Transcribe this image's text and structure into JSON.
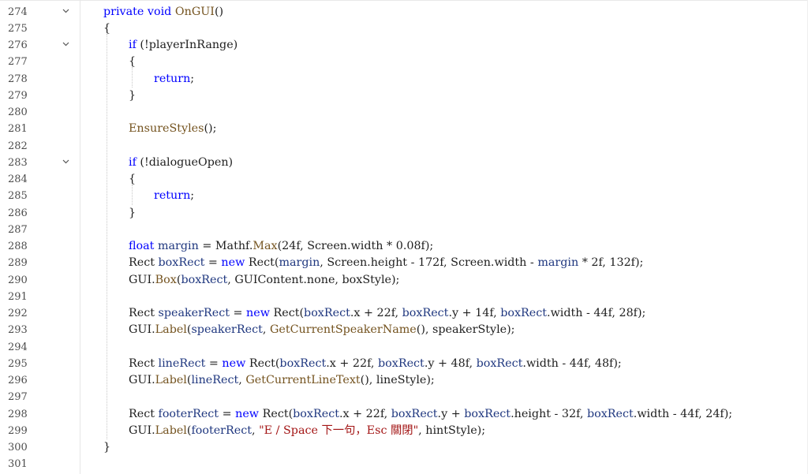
{
  "colors": {
    "keyword": "#0000ff",
    "type": "#2b91af",
    "variable": "#1f377f",
    "string": "#a31515",
    "method": "#74531f",
    "plain": "#1e1e1e",
    "line_number": "#4d4d4d"
  },
  "fold_icon": "chevron-down-icon",
  "lines": [
    {
      "n": "274",
      "fold": true,
      "indent": 0,
      "tokens": [
        {
          "t": "private",
          "c": "kw"
        },
        {
          "t": " ",
          "c": "txt"
        },
        {
          "t": "void",
          "c": "kw"
        },
        {
          "t": " ",
          "c": "txt"
        },
        {
          "t": "OnGUI",
          "c": "mth"
        },
        {
          "t": "()",
          "c": "txt"
        }
      ]
    },
    {
      "n": "275",
      "fold": false,
      "indent": 0,
      "tokens": [
        {
          "t": "{",
          "c": "txt"
        }
      ]
    },
    {
      "n": "276",
      "fold": true,
      "indent": 1,
      "tokens": [
        {
          "t": "if",
          "c": "kw"
        },
        {
          "t": " (!",
          "c": "txt"
        },
        {
          "t": "playerInRange",
          "c": "txt"
        },
        {
          "t": ")",
          "c": "txt"
        }
      ]
    },
    {
      "n": "277",
      "fold": false,
      "indent": 1,
      "tokens": [
        {
          "t": "{",
          "c": "txt"
        }
      ]
    },
    {
      "n": "278",
      "fold": false,
      "indent": 2,
      "tokens": [
        {
          "t": "return",
          "c": "kw"
        },
        {
          "t": ";",
          "c": "txt"
        }
      ]
    },
    {
      "n": "279",
      "fold": false,
      "indent": 1,
      "tokens": [
        {
          "t": "}",
          "c": "txt"
        }
      ]
    },
    {
      "n": "280",
      "fold": false,
      "indent": 0,
      "tokens": []
    },
    {
      "n": "281",
      "fold": false,
      "indent": 1,
      "tokens": [
        {
          "t": "EnsureStyles",
          "c": "mth"
        },
        {
          "t": "();",
          "c": "txt"
        }
      ]
    },
    {
      "n": "282",
      "fold": false,
      "indent": 0,
      "tokens": []
    },
    {
      "n": "283",
      "fold": true,
      "indent": 1,
      "tokens": [
        {
          "t": "if",
          "c": "kw"
        },
        {
          "t": " (!",
          "c": "txt"
        },
        {
          "t": "dialogueOpen",
          "c": "txt"
        },
        {
          "t": ")",
          "c": "txt"
        }
      ]
    },
    {
      "n": "284",
      "fold": false,
      "indent": 1,
      "tokens": [
        {
          "t": "{",
          "c": "txt"
        }
      ]
    },
    {
      "n": "285",
      "fold": false,
      "indent": 2,
      "tokens": [
        {
          "t": "return",
          "c": "kw"
        },
        {
          "t": ";",
          "c": "txt"
        }
      ]
    },
    {
      "n": "286",
      "fold": false,
      "indent": 1,
      "tokens": [
        {
          "t": "}",
          "c": "txt"
        }
      ]
    },
    {
      "n": "287",
      "fold": false,
      "indent": 0,
      "tokens": []
    },
    {
      "n": "288",
      "fold": false,
      "indent": 1,
      "tokens": [
        {
          "t": "float",
          "c": "kw"
        },
        {
          "t": " ",
          "c": "txt"
        },
        {
          "t": "margin",
          "c": "var"
        },
        {
          "t": " = ",
          "c": "txt"
        },
        {
          "t": "Mathf",
          "c": "txt"
        },
        {
          "t": ".",
          "c": "txt"
        },
        {
          "t": "Max",
          "c": "mth"
        },
        {
          "t": "(24f, ",
          "c": "txt"
        },
        {
          "t": "Screen",
          "c": "txt"
        },
        {
          "t": ".",
          "c": "txt"
        },
        {
          "t": "width",
          "c": "txt"
        },
        {
          "t": " * 0.08f);",
          "c": "txt"
        }
      ]
    },
    {
      "n": "289",
      "fold": false,
      "indent": 1,
      "tokens": [
        {
          "t": "Rect",
          "c": "txt"
        },
        {
          "t": " ",
          "c": "txt"
        },
        {
          "t": "boxRect",
          "c": "var"
        },
        {
          "t": " = ",
          "c": "txt"
        },
        {
          "t": "new",
          "c": "kw"
        },
        {
          "t": " ",
          "c": "txt"
        },
        {
          "t": "Rect",
          "c": "txt"
        },
        {
          "t": "(",
          "c": "txt"
        },
        {
          "t": "margin",
          "c": "var"
        },
        {
          "t": ", ",
          "c": "txt"
        },
        {
          "t": "Screen",
          "c": "txt"
        },
        {
          "t": ".",
          "c": "txt"
        },
        {
          "t": "height",
          "c": "txt"
        },
        {
          "t": " - 172f, ",
          "c": "txt"
        },
        {
          "t": "Screen",
          "c": "txt"
        },
        {
          "t": ".",
          "c": "txt"
        },
        {
          "t": "width",
          "c": "txt"
        },
        {
          "t": " - ",
          "c": "txt"
        },
        {
          "t": "margin",
          "c": "var"
        },
        {
          "t": " * 2f, 132f);",
          "c": "txt"
        }
      ]
    },
    {
      "n": "290",
      "fold": false,
      "indent": 1,
      "tokens": [
        {
          "t": "GUI",
          "c": "txt"
        },
        {
          "t": ".",
          "c": "txt"
        },
        {
          "t": "Box",
          "c": "mth"
        },
        {
          "t": "(",
          "c": "txt"
        },
        {
          "t": "boxRect",
          "c": "var"
        },
        {
          "t": ", ",
          "c": "txt"
        },
        {
          "t": "GUIContent",
          "c": "txt"
        },
        {
          "t": ".",
          "c": "txt"
        },
        {
          "t": "none",
          "c": "txt"
        },
        {
          "t": ", ",
          "c": "txt"
        },
        {
          "t": "boxStyle",
          "c": "txt"
        },
        {
          "t": ");",
          "c": "txt"
        }
      ]
    },
    {
      "n": "291",
      "fold": false,
      "indent": 0,
      "tokens": []
    },
    {
      "n": "292",
      "fold": false,
      "indent": 1,
      "tokens": [
        {
          "t": "Rect",
          "c": "txt"
        },
        {
          "t": " ",
          "c": "txt"
        },
        {
          "t": "speakerRect",
          "c": "var"
        },
        {
          "t": " = ",
          "c": "txt"
        },
        {
          "t": "new",
          "c": "kw"
        },
        {
          "t": " ",
          "c": "txt"
        },
        {
          "t": "Rect",
          "c": "txt"
        },
        {
          "t": "(",
          "c": "txt"
        },
        {
          "t": "boxRect",
          "c": "var"
        },
        {
          "t": ".",
          "c": "txt"
        },
        {
          "t": "x",
          "c": "txt"
        },
        {
          "t": " + 22f, ",
          "c": "txt"
        },
        {
          "t": "boxRect",
          "c": "var"
        },
        {
          "t": ".",
          "c": "txt"
        },
        {
          "t": "y",
          "c": "txt"
        },
        {
          "t": " + 14f, ",
          "c": "txt"
        },
        {
          "t": "boxRect",
          "c": "var"
        },
        {
          "t": ".",
          "c": "txt"
        },
        {
          "t": "width",
          "c": "txt"
        },
        {
          "t": " - 44f, 28f);",
          "c": "txt"
        }
      ]
    },
    {
      "n": "293",
      "fold": false,
      "indent": 1,
      "tokens": [
        {
          "t": "GUI",
          "c": "txt"
        },
        {
          "t": ".",
          "c": "txt"
        },
        {
          "t": "Label",
          "c": "mth"
        },
        {
          "t": "(",
          "c": "txt"
        },
        {
          "t": "speakerRect",
          "c": "var"
        },
        {
          "t": ", ",
          "c": "txt"
        },
        {
          "t": "GetCurrentSpeakerName",
          "c": "mth"
        },
        {
          "t": "(), ",
          "c": "txt"
        },
        {
          "t": "speakerStyle",
          "c": "txt"
        },
        {
          "t": ");",
          "c": "txt"
        }
      ]
    },
    {
      "n": "294",
      "fold": false,
      "indent": 0,
      "tokens": []
    },
    {
      "n": "295",
      "fold": false,
      "indent": 1,
      "tokens": [
        {
          "t": "Rect",
          "c": "txt"
        },
        {
          "t": " ",
          "c": "txt"
        },
        {
          "t": "lineRect",
          "c": "var"
        },
        {
          "t": " = ",
          "c": "txt"
        },
        {
          "t": "new",
          "c": "kw"
        },
        {
          "t": " ",
          "c": "txt"
        },
        {
          "t": "Rect",
          "c": "txt"
        },
        {
          "t": "(",
          "c": "txt"
        },
        {
          "t": "boxRect",
          "c": "var"
        },
        {
          "t": ".",
          "c": "txt"
        },
        {
          "t": "x",
          "c": "txt"
        },
        {
          "t": " + 22f, ",
          "c": "txt"
        },
        {
          "t": "boxRect",
          "c": "var"
        },
        {
          "t": ".",
          "c": "txt"
        },
        {
          "t": "y",
          "c": "txt"
        },
        {
          "t": " + 48f, ",
          "c": "txt"
        },
        {
          "t": "boxRect",
          "c": "var"
        },
        {
          "t": ".",
          "c": "txt"
        },
        {
          "t": "width",
          "c": "txt"
        },
        {
          "t": " - 44f, 48f);",
          "c": "txt"
        }
      ]
    },
    {
      "n": "296",
      "fold": false,
      "indent": 1,
      "tokens": [
        {
          "t": "GUI",
          "c": "txt"
        },
        {
          "t": ".",
          "c": "txt"
        },
        {
          "t": "Label",
          "c": "mth"
        },
        {
          "t": "(",
          "c": "txt"
        },
        {
          "t": "lineRect",
          "c": "var"
        },
        {
          "t": ", ",
          "c": "txt"
        },
        {
          "t": "GetCurrentLineText",
          "c": "mth"
        },
        {
          "t": "(), ",
          "c": "txt"
        },
        {
          "t": "lineStyle",
          "c": "txt"
        },
        {
          "t": ");",
          "c": "txt"
        }
      ]
    },
    {
      "n": "297",
      "fold": false,
      "indent": 0,
      "tokens": []
    },
    {
      "n": "298",
      "fold": false,
      "indent": 1,
      "tokens": [
        {
          "t": "Rect",
          "c": "txt"
        },
        {
          "t": " ",
          "c": "txt"
        },
        {
          "t": "footerRect",
          "c": "var"
        },
        {
          "t": " = ",
          "c": "txt"
        },
        {
          "t": "new",
          "c": "kw"
        },
        {
          "t": " ",
          "c": "txt"
        },
        {
          "t": "Rect",
          "c": "txt"
        },
        {
          "t": "(",
          "c": "txt"
        },
        {
          "t": "boxRect",
          "c": "var"
        },
        {
          "t": ".",
          "c": "txt"
        },
        {
          "t": "x",
          "c": "txt"
        },
        {
          "t": " + 22f, ",
          "c": "txt"
        },
        {
          "t": "boxRect",
          "c": "var"
        },
        {
          "t": ".",
          "c": "txt"
        },
        {
          "t": "y",
          "c": "txt"
        },
        {
          "t": " + ",
          "c": "txt"
        },
        {
          "t": "boxRect",
          "c": "var"
        },
        {
          "t": ".",
          "c": "txt"
        },
        {
          "t": "height",
          "c": "txt"
        },
        {
          "t": " - 32f, ",
          "c": "txt"
        },
        {
          "t": "boxRect",
          "c": "var"
        },
        {
          "t": ".",
          "c": "txt"
        },
        {
          "t": "width",
          "c": "txt"
        },
        {
          "t": " - 44f, 24f);",
          "c": "txt"
        }
      ]
    },
    {
      "n": "299",
      "fold": false,
      "indent": 1,
      "tokens": [
        {
          "t": "GUI",
          "c": "txt"
        },
        {
          "t": ".",
          "c": "txt"
        },
        {
          "t": "Label",
          "c": "mth"
        },
        {
          "t": "(",
          "c": "txt"
        },
        {
          "t": "footerRect",
          "c": "var"
        },
        {
          "t": ", ",
          "c": "txt"
        },
        {
          "t": "\"E / Space 下一句，Esc 關閉\"",
          "c": "str"
        },
        {
          "t": ", ",
          "c": "txt"
        },
        {
          "t": "hintStyle",
          "c": "txt"
        },
        {
          "t": ");",
          "c": "txt"
        }
      ]
    },
    {
      "n": "300",
      "fold": false,
      "indent": 0,
      "tokens": [
        {
          "t": "}",
          "c": "txt"
        }
      ]
    },
    {
      "n": "301",
      "fold": false,
      "indent": 0,
      "tokens": []
    }
  ]
}
